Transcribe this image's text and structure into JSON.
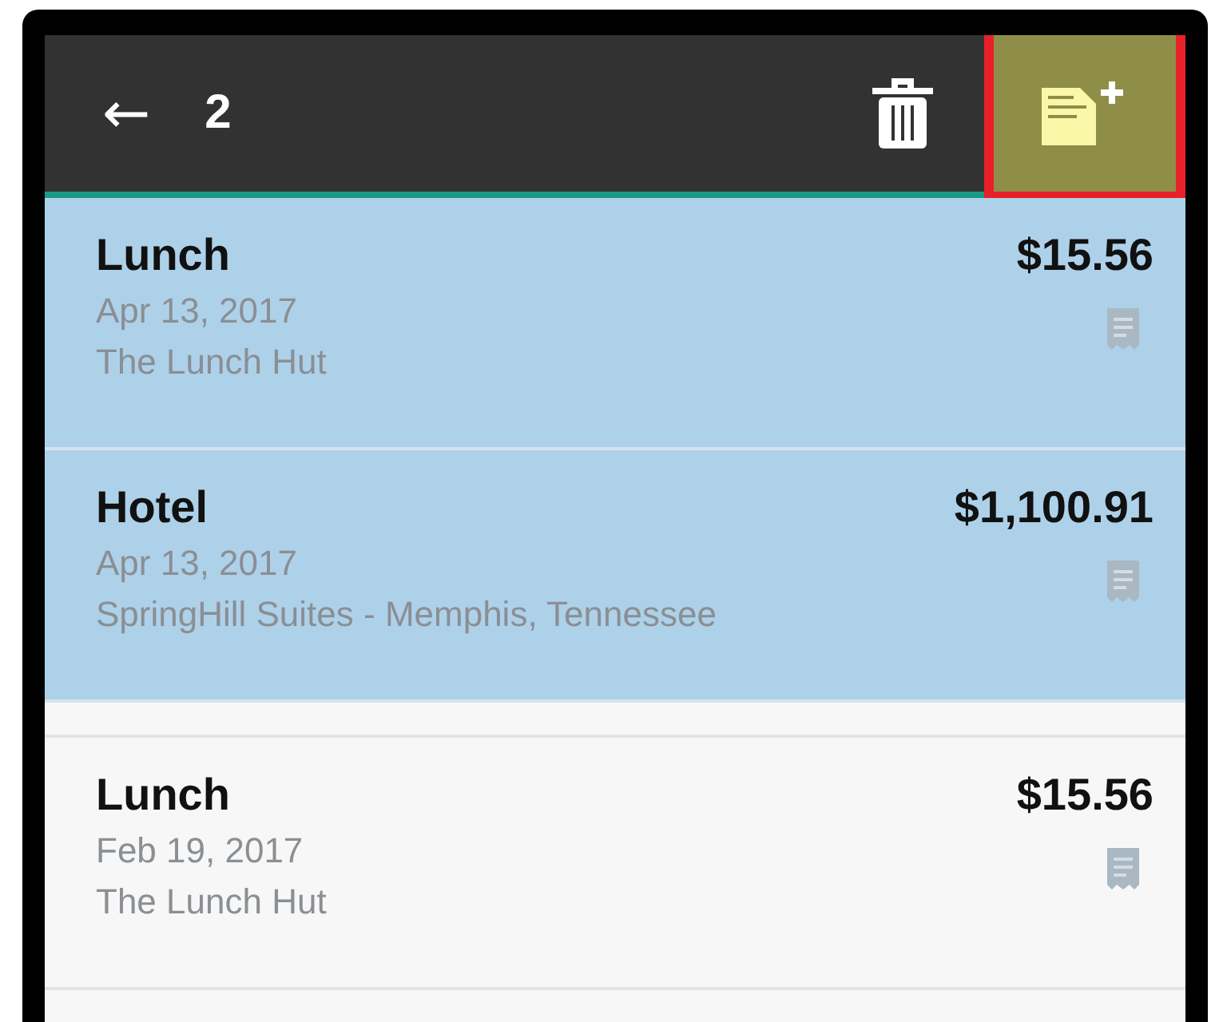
{
  "toolbar": {
    "back": "←",
    "count": "2",
    "add_highlighted": true
  },
  "expenses": [
    {
      "title": "Lunch",
      "amount": "$15.56",
      "date": "Apr 13, 2017",
      "merchant": "The Lunch Hut",
      "selected": true
    },
    {
      "title": "Hotel",
      "amount": "$1,100.91",
      "date": "Apr 13, 2017",
      "merchant": "SpringHill Suites - Memphis, Tennessee",
      "selected": true
    },
    {
      "title": "Lunch",
      "amount": "$15.56",
      "date": "Feb 19, 2017",
      "merchant": "The Lunch Hut",
      "selected": false
    }
  ]
}
